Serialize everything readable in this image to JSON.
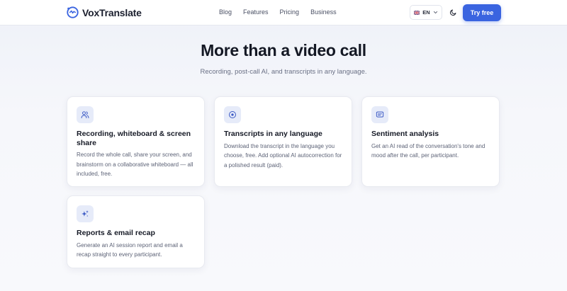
{
  "brand": {
    "name": "VoxTranslate",
    "logo_icon": "vox-logo-icon"
  },
  "nav": {
    "links": [
      "Blog",
      "Features",
      "Pricing",
      "Business"
    ],
    "language": {
      "code": "EN",
      "flag_icon": "uk-flag-icon"
    },
    "theme_icon": "moon-icon",
    "cta_label": "Try free"
  },
  "colors": {
    "accent": "#3a64e0",
    "icon_bg": "#e6ebf9"
  },
  "hero": {
    "title": "More than a video call",
    "subtitle": "Recording, post-call AI, and transcripts in any language."
  },
  "features": [
    {
      "icon": "users-icon",
      "title": "Recording, whiteboard & screen share",
      "description": "Record the whole call, share your screen, and brainstorm on a collaborative whiteboard — all included, free."
    },
    {
      "icon": "record-icon",
      "title": "Transcripts in any language",
      "description": "Download the transcript in the language you choose, free. Add optional AI autocorrection for a polished result (paid)."
    },
    {
      "icon": "message-icon",
      "title": "Sentiment analysis",
      "description": "Get an AI read of the conversation's tone and mood after the call, per participant."
    },
    {
      "icon": "sparkles-icon",
      "title": "Reports & email recap",
      "description": "Generate an AI session report and email a recap straight to every participant."
    }
  ]
}
